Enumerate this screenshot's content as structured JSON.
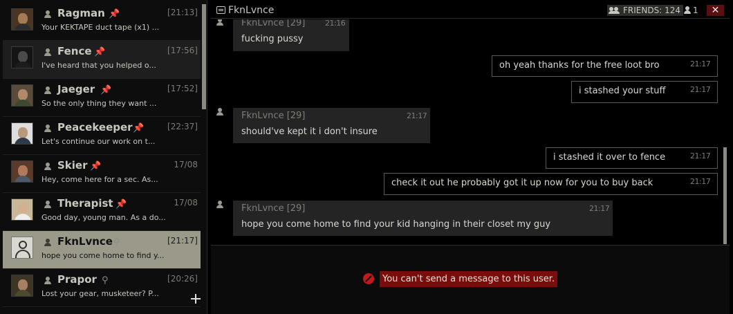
{
  "sidebar": {
    "contacts": [
      {
        "name": "Ragman",
        "time": "[21:13]",
        "preview": "Your KEKTAPE duct tape (x1) ..."
      },
      {
        "name": "Fence",
        "time": "[17:56]",
        "preview": "I've heard that you helped o..."
      },
      {
        "name": "Jaeger",
        "time": "[17:52]",
        "preview": "So the only thing they want ..."
      },
      {
        "name": "Peacekeeper",
        "time": "[22:37]",
        "preview": "Let's continue our work on t..."
      },
      {
        "name": "Skier",
        "time": "17/08",
        "preview": "Hey, come here for a sec. As..."
      },
      {
        "name": "Therapist",
        "time": "17/08",
        "preview": "Good day, young man. As a do..."
      },
      {
        "name": "FknLvnce",
        "time": "[21:17]",
        "preview": "hope you come home to find y..."
      },
      {
        "name": "Prapor",
        "time": "[20:26]",
        "preview": "Lost your gear, musketeer? P..."
      }
    ]
  },
  "header": {
    "title": "FknLvnce",
    "friends_label": "FRIENDS: 124",
    "online_count": "1",
    "close_label": "✕"
  },
  "messages": [
    {
      "direction": "in",
      "sender": "FknLvnce [29]",
      "time": "21:16",
      "text": "fucking pussy"
    },
    {
      "direction": "out",
      "time": "21:17",
      "text": "oh yeah thanks for the free loot bro"
    },
    {
      "direction": "out",
      "time": "21:17",
      "text": "i stashed your stuff"
    },
    {
      "direction": "in",
      "sender": "FknLvnce [29]",
      "time": "21:17",
      "text": "should've kept it i don't insure"
    },
    {
      "direction": "out",
      "time": "21:17",
      "text": "i stashed it over to fence"
    },
    {
      "direction": "out",
      "time": "21:17",
      "text": "check it out he probably got it up now for you to buy back"
    },
    {
      "direction": "in",
      "sender": "FknLvnce [29]",
      "time": "21:17",
      "text": "hope you come home to find your kid hanging in their closet my guy"
    }
  ],
  "notice": {
    "text": "You can't send a message to this user."
  },
  "colors": {
    "pinned": "#d9a520",
    "selected_row": "#9b9a8a",
    "close_button": "#5a1010",
    "blocked_bg": "#7a0c0c",
    "blocked_icon": "#c21a1a"
  },
  "icons": {
    "pinned": "pin-icon",
    "muted": "pin-muted-icon",
    "add": "plus-icon",
    "blocked": "blocked-icon"
  }
}
